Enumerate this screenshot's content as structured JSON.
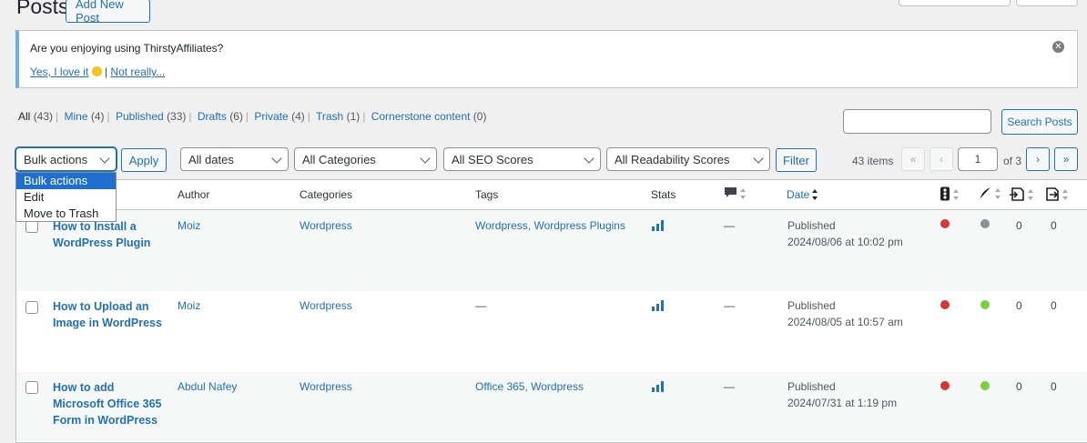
{
  "header": {
    "title": "Posts",
    "add_new_label": "Add New Post"
  },
  "notice": {
    "question": "Are you enjoying using ThirstyAffiliates?",
    "yes_label": "Yes, I love it",
    "separator": "|",
    "no_label": "Not really..."
  },
  "views": [
    {
      "label": "All",
      "count": "(43)"
    },
    {
      "label": "Mine",
      "count": "(4)"
    },
    {
      "label": "Published",
      "count": "(33)"
    },
    {
      "label": "Drafts",
      "count": "(6)"
    },
    {
      "label": "Private",
      "count": "(4)"
    },
    {
      "label": "Trash",
      "count": "(1)"
    },
    {
      "label": "Cornerstone content",
      "count": "(0)"
    }
  ],
  "search": {
    "value": "",
    "button_label": "Search Posts"
  },
  "filters": {
    "bulk_actions": "Bulk actions",
    "apply_label": "Apply",
    "dates": "All dates",
    "categories": "All Categories",
    "seo": "All SEO Scores",
    "readability": "All Readability Scores",
    "filter_label": "Filter"
  },
  "bulk_menu": [
    "Bulk actions",
    "Edit",
    "Move to Trash"
  ],
  "pagination": {
    "items": "43 items",
    "first": "«",
    "prev": "‹",
    "page": "1",
    "of": "of 3",
    "next": "›",
    "last": "»"
  },
  "columns": {
    "author": "Author",
    "categories": "Categories",
    "tags": "Tags",
    "stats": "Stats",
    "date": "Date"
  },
  "rows": [
    {
      "title": "How to Install a WordPress Plugin",
      "author": "Moiz",
      "category": "Wordpress",
      "tags": "Wordpress, Wordpress Plugins",
      "comments": "—",
      "status": "Published",
      "date": "2024/08/06 at 10:02 pm",
      "seo": "#d63638",
      "readability": "#8c8f94",
      "links_out": "0",
      "links_in": "0"
    },
    {
      "title": "How to Upload an Image in WordPress",
      "author": "Moiz",
      "category": "Wordpress",
      "tags": "—",
      "comments": "—",
      "status": "Published",
      "date": "2024/08/05 at 10:57 am",
      "seo": "#d63638",
      "readability": "#7ad03a",
      "links_out": "0",
      "links_in": "0"
    },
    {
      "title": "How to add Microsoft Office 365 Form in WordPress",
      "author": "Abdul Nafey",
      "category": "Wordpress",
      "tags": "Office 365, Wordpress",
      "comments": "—",
      "status": "Published",
      "date": "2024/07/31 at 1:19 pm",
      "seo": "#d63638",
      "readability": "#7ad03a",
      "links_out": "0",
      "links_in": "0"
    }
  ]
}
